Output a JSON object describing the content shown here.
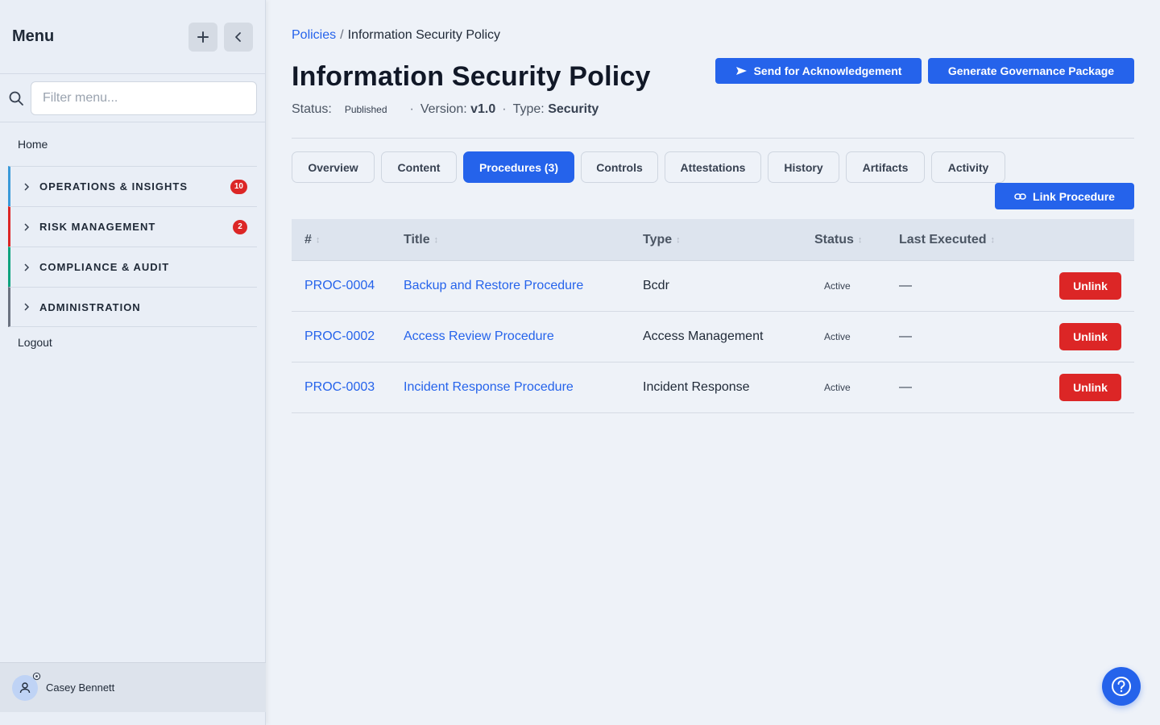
{
  "sidebar": {
    "title": "Menu",
    "filter_placeholder": "Filter menu...",
    "home": "Home",
    "groups": [
      {
        "label": "OPERATIONS & INSIGHTS",
        "badge": "10",
        "accent": "#3b9ad9"
      },
      {
        "label": "RISK MANAGEMENT",
        "badge": "2",
        "accent": "#dc2626"
      },
      {
        "label": "COMPLIANCE & AUDIT",
        "badge": "",
        "accent": "#10a37f"
      },
      {
        "label": "ADMINISTRATION",
        "badge": "",
        "accent": "#6b7280"
      }
    ],
    "logout": "Logout",
    "user_name": "Casey Bennett"
  },
  "breadcrumb": {
    "parent": "Policies",
    "separator": "/",
    "current": "Information Security Policy"
  },
  "page": {
    "title": "Information Security Policy",
    "status_label": "Status:",
    "status_value": "Published",
    "version_label": "Version:",
    "version_value": "v1.0",
    "type_label": "Type:",
    "type_value": "Security"
  },
  "actions": {
    "send_ack": "Send for Acknowledgement",
    "generate_package": "Generate Governance Package",
    "link_procedure": "Link Procedure"
  },
  "tabs": [
    "Overview",
    "Content",
    "Procedures (3)",
    "Controls",
    "Attestations",
    "History",
    "Artifacts",
    "Activity"
  ],
  "active_tab": "Procedures (3)",
  "table": {
    "headers": [
      "#",
      "Title",
      "Type",
      "Status",
      "Last Executed"
    ],
    "rows": [
      {
        "id": "PROC-0004",
        "title": "Backup and Restore Procedure",
        "type": "Bcdr",
        "status": "Active",
        "last_executed": "—",
        "action": "Unlink"
      },
      {
        "id": "PROC-0002",
        "title": "Access Review Procedure",
        "type": "Access Management",
        "status": "Active",
        "last_executed": "—",
        "action": "Unlink"
      },
      {
        "id": "PROC-0003",
        "title": "Incident Response Procedure",
        "type": "Incident Response",
        "status": "Active",
        "last_executed": "—",
        "action": "Unlink"
      }
    ]
  },
  "colors": {
    "primary": "#2563eb",
    "danger": "#dc2626",
    "background": "#eef2f8"
  }
}
